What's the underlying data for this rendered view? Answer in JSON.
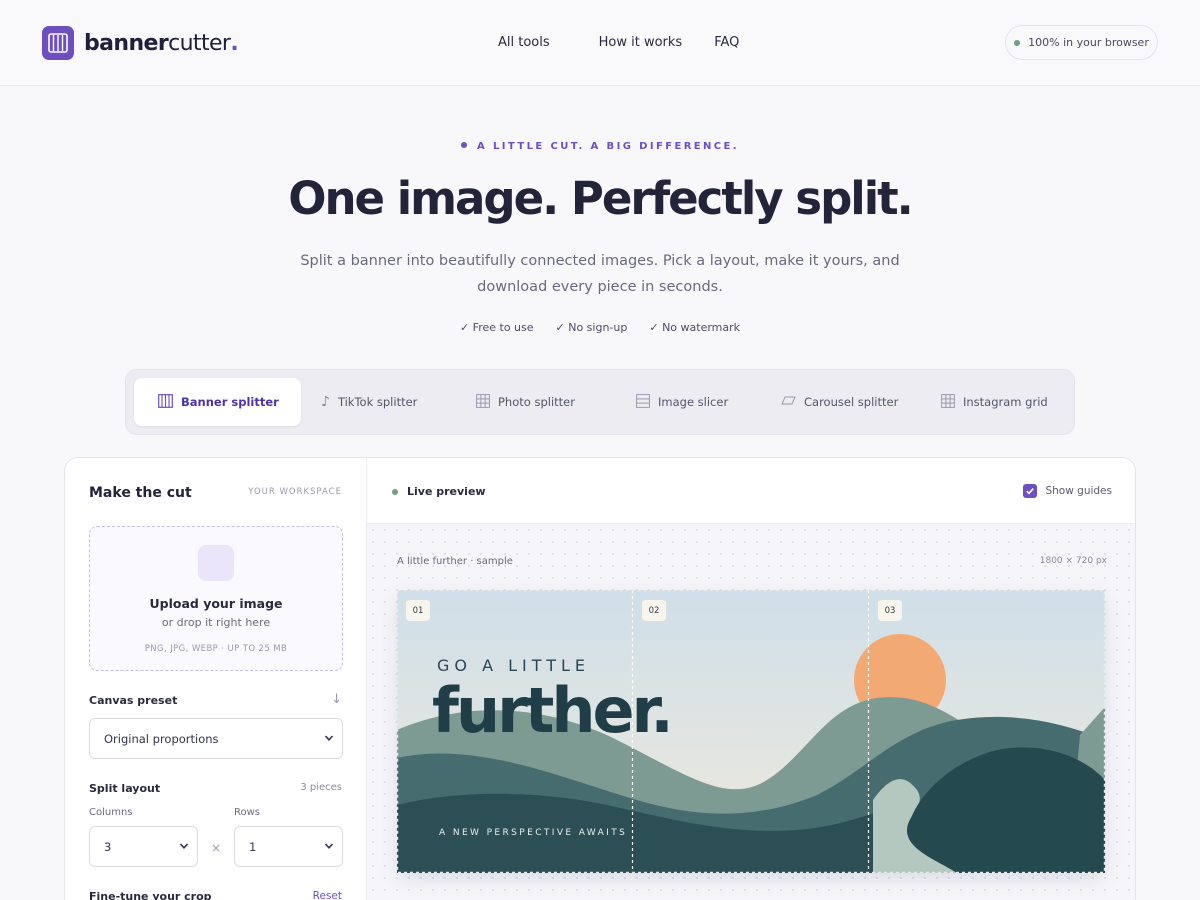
{
  "brand": {
    "name_bold": "banner",
    "name_rest": "cutter",
    "name_dot": "."
  },
  "nav": {
    "items": [
      "All tools",
      "How it works",
      "FAQ"
    ]
  },
  "status_pill": {
    "label": "100% in your browser",
    "dot_color": "#6f9f84"
  },
  "hero": {
    "eyebrow": "A LITTLE CUT. A BIG DIFFERENCE.",
    "title": "One image. Perfectly split.",
    "subtitle": "Split a banner into beautifully connected images. Pick a layout, make it yours, and download every piece in seconds.",
    "perks": [
      "✓ Free to use",
      "✓ No sign-up",
      "✓ No watermark"
    ]
  },
  "tools": [
    {
      "label": "Banner splitter",
      "icon": "columns-icon",
      "active": true
    },
    {
      "label": "TikTok splitter",
      "icon": "music-note-icon",
      "active": false
    },
    {
      "label": "Photo splitter",
      "icon": "grid-icon",
      "active": false
    },
    {
      "label": "Image slicer",
      "icon": "rows-icon",
      "active": false
    },
    {
      "label": "Carousel splitter",
      "icon": "parallelogram-icon",
      "active": false
    },
    {
      "label": "Instagram grid",
      "icon": "grid-icon",
      "active": false
    }
  ],
  "workspace": {
    "title": "Make the cut",
    "kicker": "YOUR WORKSPACE",
    "upload": {
      "title": "Upload your image",
      "subtitle": "or drop it right here",
      "hint": "PNG, JPG, WEBP · UP TO 25 MB"
    },
    "canvas_preset": {
      "label": "Canvas preset",
      "value": "Original proportions"
    },
    "split_layout": {
      "label": "Split layout",
      "pieces": "3 pieces",
      "columns_label": "Columns",
      "columns_value": "3",
      "rows_label": "Rows",
      "rows_value": "1",
      "times": "×"
    },
    "fine_tune": {
      "label": "Fine-tune your crop",
      "reset": "Reset"
    }
  },
  "preview": {
    "label": "Live preview",
    "show_guides_label": "Show guides",
    "show_guides_checked": true,
    "sample_name": "A little further · sample",
    "sample_size": "1800 × 720 px",
    "piece_labels": [
      "01",
      "02",
      "03"
    ],
    "banner": {
      "kicker": "GO A LITTLE",
      "title": "further.",
      "tagline": "A NEW PERSPECTIVE AWAITS"
    }
  },
  "colors": {
    "accent": "#6d4fc1",
    "text": "#23233a",
    "status_green": "#6f9f84"
  }
}
